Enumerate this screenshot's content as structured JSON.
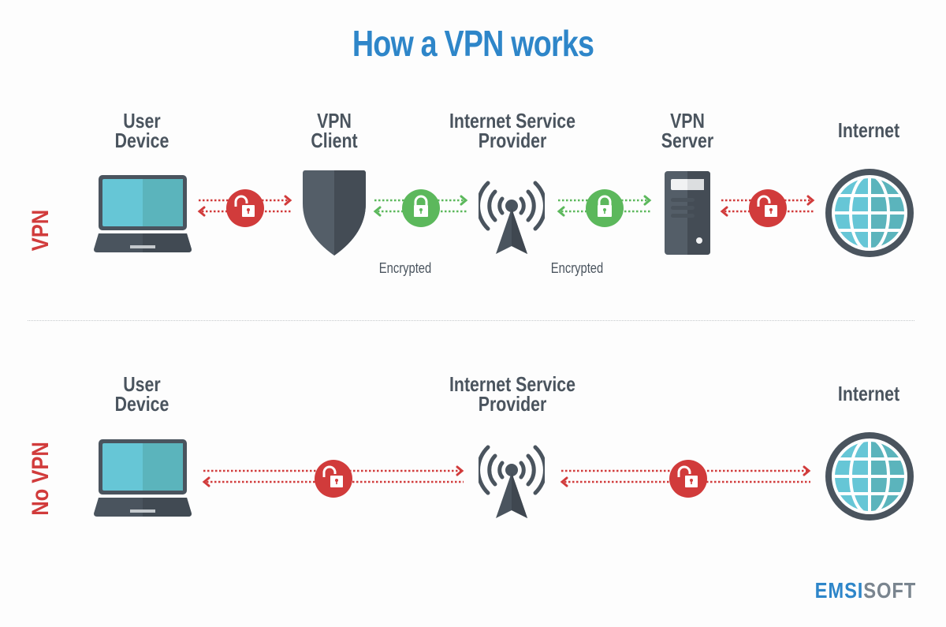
{
  "title": "How a VPN works",
  "colors": {
    "title": "#2e86c9",
    "label_text": "#4a545e",
    "unencrypted": "#d13b3b",
    "encrypted": "#5cb85c",
    "icon_dark": "#4a545e",
    "screen": "#66c6d6"
  },
  "vpn_row": {
    "row_label": "VPN",
    "nodes": [
      {
        "label_line1": "User",
        "label_line2": "Device",
        "icon": "laptop-icon"
      },
      {
        "label_line1": "VPN",
        "label_line2": "Client",
        "icon": "shield-icon"
      },
      {
        "label_line1": "Internet Service",
        "label_line2": "Provider",
        "icon": "antenna-icon"
      },
      {
        "label_line1": "VPN",
        "label_line2": "Server",
        "icon": "server-icon"
      },
      {
        "label_line1": "Internet",
        "label_line2": "",
        "icon": "globe-icon"
      }
    ],
    "links": [
      {
        "status": "unencrypted",
        "icon": "unlocked-padlock-icon",
        "caption": ""
      },
      {
        "status": "encrypted",
        "icon": "locked-padlock-icon",
        "caption": "Encrypted"
      },
      {
        "status": "encrypted",
        "icon": "locked-padlock-icon",
        "caption": "Encrypted"
      },
      {
        "status": "unencrypted",
        "icon": "unlocked-padlock-icon",
        "caption": ""
      }
    ]
  },
  "novpn_row": {
    "row_label": "No VPN",
    "nodes": [
      {
        "label_line1": "User",
        "label_line2": "Device",
        "icon": "laptop-icon"
      },
      {
        "label_line1": "Internet Service",
        "label_line2": "Provider",
        "icon": "antenna-icon"
      },
      {
        "label_line1": "Internet",
        "label_line2": "",
        "icon": "globe-icon"
      }
    ],
    "links": [
      {
        "status": "unencrypted",
        "icon": "unlocked-padlock-icon"
      },
      {
        "status": "unencrypted",
        "icon": "unlocked-padlock-icon"
      }
    ]
  },
  "brand": {
    "part1": "EMSI",
    "part2": "SOFT"
  }
}
